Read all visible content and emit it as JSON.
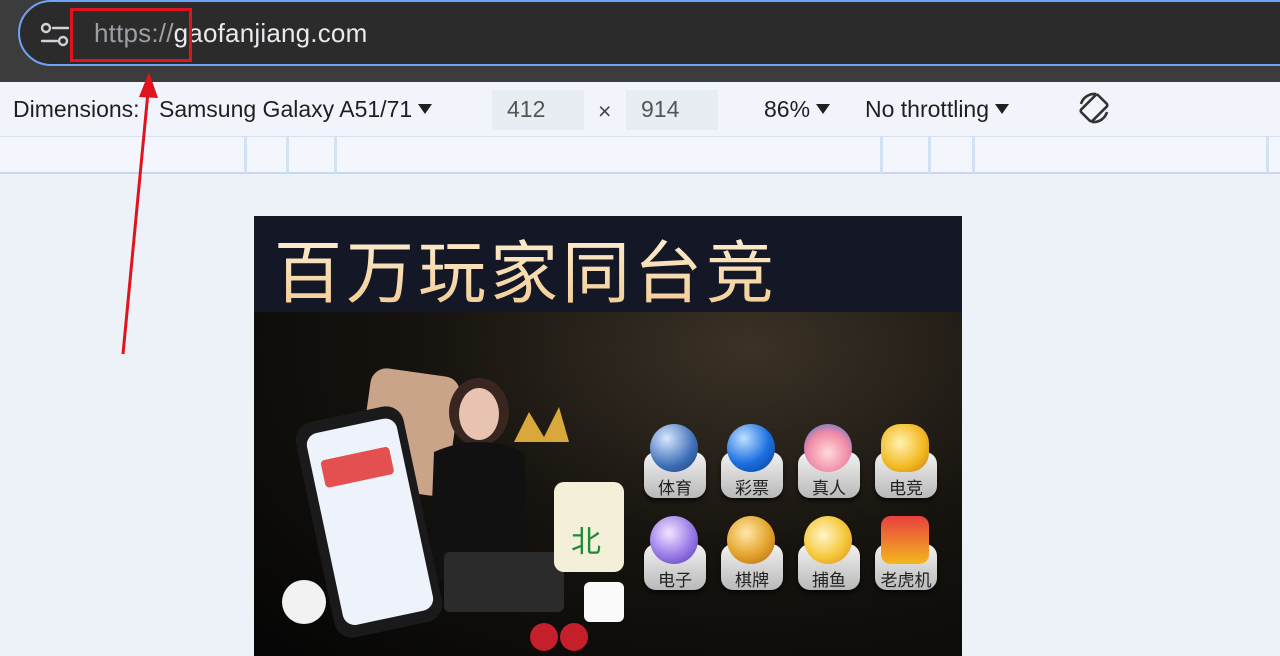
{
  "browser": {
    "url_scheme": "https://",
    "url_host": "gaofanjiang.com"
  },
  "device_toolbar": {
    "dimensions_label": "Dimensions:",
    "device_name": "Samsung Galaxy A51/71",
    "width": "412",
    "times_symbol": "×",
    "height": "914",
    "zoom": "86%",
    "throttling": "No throttling"
  },
  "page": {
    "headline": "百万玩家同台竞",
    "games": [
      {
        "label": "体育",
        "icon": "soccer-ball-icon"
      },
      {
        "label": "彩票",
        "icon": "lottery-ball-icon"
      },
      {
        "label": "真人",
        "icon": "live-dealer-icon"
      },
      {
        "label": "电竞",
        "icon": "gamepad-icon"
      },
      {
        "label": "电子",
        "icon": "robot-icon"
      },
      {
        "label": "棋牌",
        "icon": "mahjong-tile-icon"
      },
      {
        "label": "捕鱼",
        "icon": "pufferfish-icon"
      },
      {
        "label": "老虎机",
        "icon": "slot-machine-icon"
      }
    ],
    "mahjong_char": "北"
  },
  "colors": {
    "highlight_box": "#e0141e",
    "omnibox_border": "#6ea3f5"
  }
}
